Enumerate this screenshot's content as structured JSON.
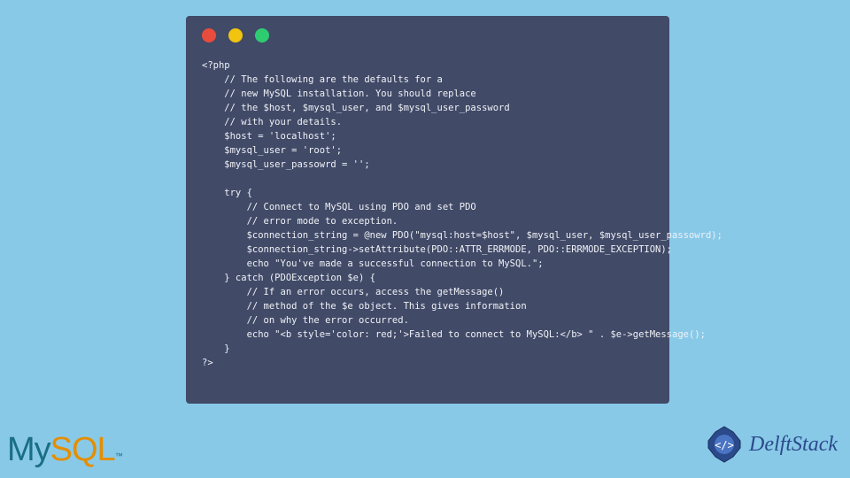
{
  "code": {
    "lines": [
      "<?php",
      "    // The following are the defaults for a",
      "    // new MySQL installation. You should replace",
      "    // the $host, $mysql_user, and $mysql_user_password",
      "    // with your details.",
      "    $host = 'localhost';",
      "    $mysql_user = 'root';",
      "    $mysql_user_passowrd = '';",
      "",
      "    try {",
      "        // Connect to MySQL using PDO and set PDO",
      "        // error mode to exception.",
      "        $connection_string = @new PDO(\"mysql:host=$host\", $mysql_user, $mysql_user_passowrd);",
      "        $connection_string->setAttribute(PDO::ATTR_ERRMODE, PDO::ERRMODE_EXCEPTION);",
      "        echo \"You've made a successful connection to MySQL.\";",
      "    } catch (PDOException $e) {",
      "        // If an error occurs, access the getMessage()",
      "        // method of the $e object. This gives information",
      "        // on why the error occurred.",
      "        echo \"<b style='color: red;'>Failed to connect to MySQL:</b> \" . $e->getMessage();",
      "    }",
      "?>"
    ]
  },
  "logos": {
    "mysql_my": "My",
    "mysql_sql": "SQL",
    "mysql_tm": "™",
    "delft": "DelftStack"
  }
}
